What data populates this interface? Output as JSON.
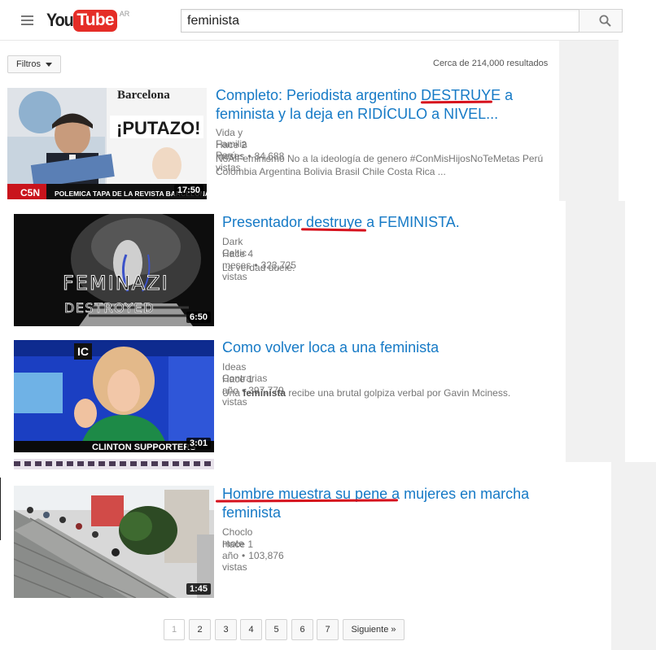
{
  "header": {
    "logo_you": "You",
    "logo_tube": "Tube",
    "logo_country": "AR",
    "search_value": "feminista"
  },
  "filters": {
    "button_label": "Filtros",
    "result_count": "Cerca de 214,000 resultados"
  },
  "results": [
    {
      "title_line1": "Completo: Periodista argentino DESTRUYE a",
      "title_line2": "feminista y la deja en RIDÍCULO a NIVEL...",
      "channel": "Vida y Familia Perú",
      "age": "Hace 2 meses",
      "views": "84,688 vistas",
      "desc_line1": "NoAlFeminismo No a la ideología de genero #ConMisHijosNoTeMetas Perú",
      "desc_line2": "Colombia Argentina Bolivia Brasil Chile Costa Rica ...",
      "duration": "17:50",
      "thumb_text1": "Barcelona",
      "thumb_text2": "¡PUTAZO!",
      "thumb_text3": "C5N",
      "thumb_text4": "POLEMICA TAPA DE LA REVISTA BARCELONA"
    },
    {
      "title_line1": "Presentador destruye a FEMINISTA.",
      "channel": "Dark Celtic",
      "age": "Hace 4 meses",
      "views": "323,725 vistas",
      "desc_line1": "La verdad duele.",
      "duration": "6:50",
      "thumb_text1": "FEMINAZI",
      "thumb_text2": "DESTROYED"
    },
    {
      "title_line1": "Como volver loca a una feminista",
      "channel": "Ideas Contrarias",
      "age": "Hace 1 año",
      "views": "397,779 vistas",
      "desc_pre": "Una ",
      "desc_bold": "feminista",
      "desc_post": " recibe una brutal golpiza verbal por Gavin Mciness.",
      "duration": "3:01",
      "thumb_text1": "IC",
      "thumb_text2": "CLINTON SUPPORTERS"
    },
    {
      "title_line1": "Hombre muestra su pene a mujeres en marcha",
      "title_line2": "feminista",
      "channel": "Choclo mote",
      "age": "Hace 1 año",
      "views": "103,876 vistas",
      "duration": "1:45"
    }
  ],
  "pagination": {
    "pages": [
      "1",
      "2",
      "3",
      "4",
      "5",
      "6",
      "7"
    ],
    "next_label": "Siguiente »"
  },
  "colors": {
    "link_blue": "#167ac6",
    "brand_red": "#e52d27",
    "annotation_red": "#d6101c"
  }
}
